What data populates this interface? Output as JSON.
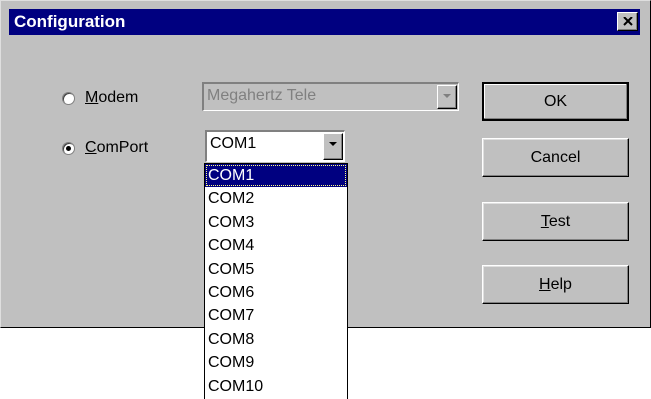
{
  "window": {
    "title": "Configuration"
  },
  "options": {
    "modem": {
      "label_accel": "M",
      "label_rest": "odem",
      "selected": false,
      "value": "Megahertz Tele"
    },
    "comport": {
      "label_accel": "C",
      "label_rest": "omPort",
      "selected": true,
      "value": "COM1"
    }
  },
  "dropdown": {
    "items": [
      "COM1",
      "COM2",
      "COM3",
      "COM4",
      "COM5",
      "COM6",
      "COM7",
      "COM8",
      "COM9",
      "COM10"
    ],
    "selected_index": 0
  },
  "buttons": {
    "ok": "OK",
    "cancel": "Cancel",
    "test": {
      "accel": "T",
      "rest": "est"
    },
    "help": {
      "accel": "H",
      "rest": "elp"
    }
  },
  "icons": {
    "close": "close-icon",
    "dropdown": "chevron-down-icon"
  },
  "colors": {
    "titlebar": "#000080",
    "face": "#c0c0c0",
    "highlight": "#000080"
  }
}
